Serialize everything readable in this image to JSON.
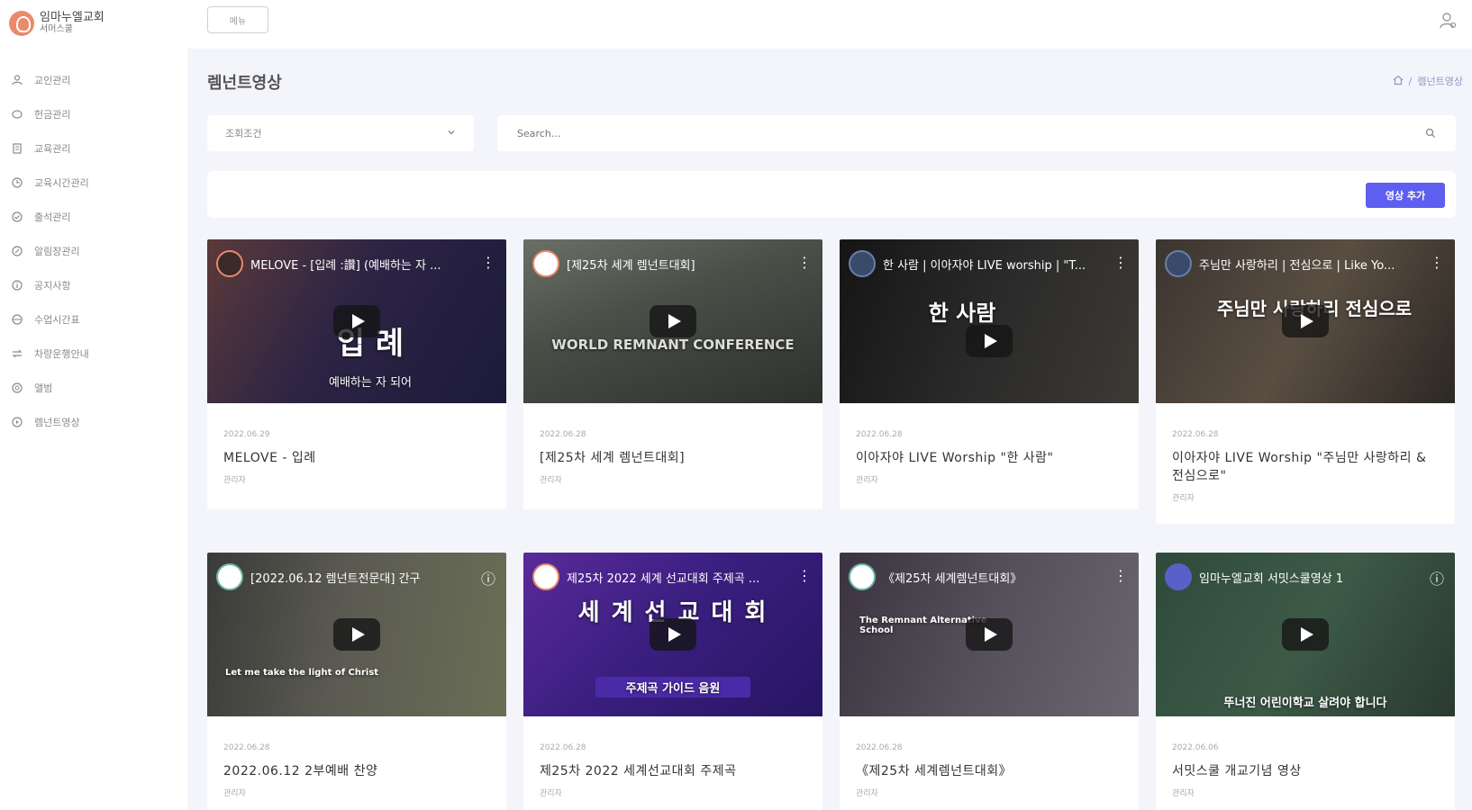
{
  "sidebar": {
    "logo_title": "임마누엘교회",
    "logo_sub": "서머스쿨",
    "items": [
      {
        "label": "교인관리",
        "icon": "person-icon"
      },
      {
        "label": "헌금관리",
        "icon": "coin-icon"
      },
      {
        "label": "교육관리",
        "icon": "book-icon"
      },
      {
        "label": "교육시간관리",
        "icon": "clock-icon"
      },
      {
        "label": "출석관리",
        "icon": "check-icon"
      },
      {
        "label": "알림장관리",
        "icon": "edit-icon"
      },
      {
        "label": "공지사항",
        "icon": "info-icon"
      },
      {
        "label": "수업시간표",
        "icon": "calendar-icon"
      },
      {
        "label": "차량운행안내",
        "icon": "transfer-icon"
      },
      {
        "label": "앨범",
        "icon": "album-icon"
      },
      {
        "label": "렘넌트영상",
        "icon": "video-icon"
      }
    ]
  },
  "topbar": {
    "menu_label": "메뉴"
  },
  "page": {
    "title": "렘넌트영상",
    "breadcrumb_current": "렘넌트영상"
  },
  "filters": {
    "select_value": "조회조건",
    "search_placeholder": "Search..."
  },
  "actions": {
    "add_label": "영상 추가"
  },
  "videos": [
    {
      "thumb_title": "MELOVE - [입례 :讚] (예배하는 자 ...",
      "overlay": "입 례",
      "overlay_sub": "예배하는 자 되어",
      "date": "2022.06.29",
      "title": "MELOVE - 입례",
      "author": "관리자"
    },
    {
      "thumb_title": "[제25차 세계 렘넌트대회]",
      "overlay": "WORLD REMNANT CONFERENCE",
      "overlay_sub": "",
      "date": "2022.06.28",
      "title": "[제25차 세계 렘넌트대회]",
      "author": "관리자"
    },
    {
      "thumb_title": "한 사람 | 이아자야 LIVE worship | \"T...",
      "overlay": "한 사람",
      "overlay_sub": "",
      "date": "2022.06.28",
      "title": "이아자야 LIVE Worship \"한 사람\"",
      "author": "관리자"
    },
    {
      "thumb_title": "주님만 사랑하리 | 전심으로 | Like Yo...",
      "overlay": "주님만 사랑하리 전심으로",
      "overlay_sub": "",
      "date": "2022.06.28",
      "title": "이아자야 LIVE Worship \"주님만 사랑하리 & 전심으로\"",
      "author": "관리자"
    },
    {
      "thumb_title": "[2022.06.12 렘넌트전문대] 간구",
      "overlay": "Let me take the light of Christ",
      "overlay_sub": "",
      "date": "2022.06.28",
      "title": "2022.06.12 2부예배 찬양",
      "author": "관리자"
    },
    {
      "thumb_title": "제25차 2022 세계 선교대회 주제곡 ...",
      "overlay": "세 계 선 교 대 회",
      "overlay_sub": "주제곡 가이드 음원",
      "date": "2022.06.28",
      "title": "제25차 2022 세계선교대회 주제곡",
      "author": "관리자"
    },
    {
      "thumb_title": "《제25차 세계렘넌트대회》",
      "overlay": "The Remnant Alternative School",
      "overlay_sub": "",
      "date": "2022.06.28",
      "title": "《제25차 세계렘넌트대회》",
      "author": "관리자"
    },
    {
      "thumb_title": "임마누엘교회 서밋스쿨영상 1",
      "overlay": "뚜너진 어린이학교 살려야 합니다",
      "overlay_sub": "",
      "date": "2022.06.06",
      "title": "서밋스쿨 개교기념 영상",
      "author": "관리자"
    }
  ],
  "colors": {
    "accent": "#5e5ef0",
    "breadcrumb": "#8f96c7",
    "page_bg": "#f4f5fb"
  }
}
